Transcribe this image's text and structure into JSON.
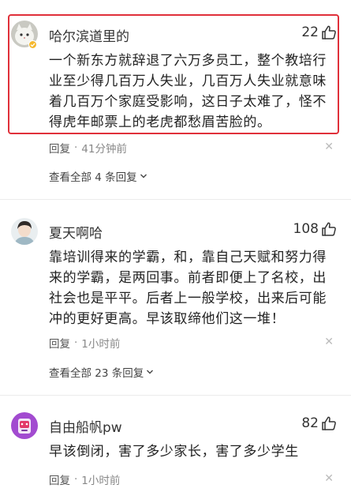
{
  "comments": [
    {
      "username": "哈尔滨道里的",
      "likes": "22",
      "text": "一个新东方就辞退了六万多员工，整个教培行业至少得几百万人失业，几百万人失业就意味着几百万个家庭受影响，这日子太难了，怪不得虎年邮票上的老虎都愁眉苦脸的。",
      "reply_label": "回复",
      "time": "41分钟前",
      "view_all": "查看全部 4 条回复",
      "highlighted": true
    },
    {
      "username": "夏天啊哈",
      "likes": "108",
      "text": "靠培训得来的学霸，和，靠自己天赋和努力得来的学霸，是两回事。前者即便上了名校，出社会也是平平。后者上一般学校，出来后可能冲的更好更高。早该取缔他们这一堆！",
      "reply_label": "回复",
      "time": "1小时前",
      "view_all": "查看全部 23 条回复"
    },
    {
      "username": "自由船帆pw",
      "likes": "82",
      "text": "早该倒闭，害了多少家长，害了多少学生",
      "reply_label": "回复",
      "time": "1小时前"
    }
  ],
  "icons": {
    "like": "thumbs-up-icon",
    "close": "close-icon",
    "chevron": "chevron-down-icon"
  },
  "colors": {
    "highlight_border": "#e0303a",
    "text_primary": "#222222",
    "text_meta": "#888888"
  }
}
